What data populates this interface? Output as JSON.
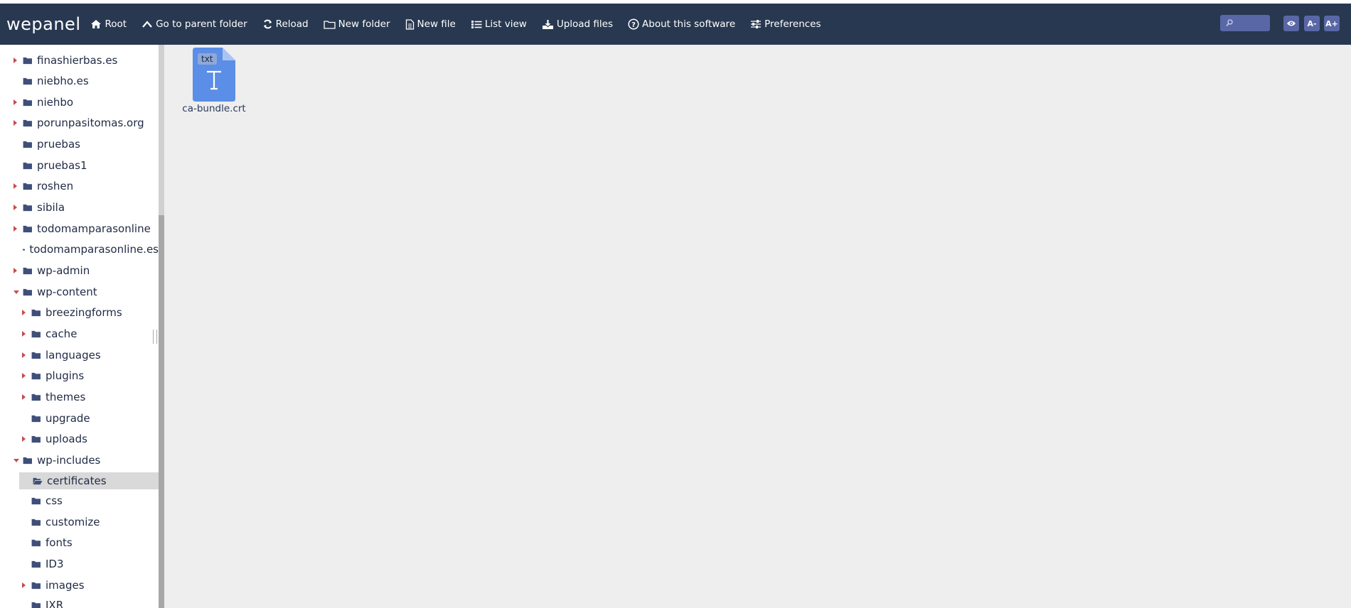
{
  "app": {
    "logo": "wepanel"
  },
  "toolbar": {
    "root": "Root",
    "parent": "Go to parent folder",
    "reload": "Reload",
    "new_folder": "New folder",
    "new_file": "New file",
    "list_view": "List view",
    "upload": "Upload files",
    "about": "About this software",
    "preferences": "Preferences"
  },
  "search": {
    "placeholder": ""
  },
  "buttons": {
    "font_decrease": "A-",
    "font_increase": "A+"
  },
  "tree": {
    "items": [
      {
        "label": "finashierbas.es"
      },
      {
        "label": "niebho.es"
      },
      {
        "label": "niehbo"
      },
      {
        "label": "porunpasitomas.org"
      },
      {
        "label": "pruebas"
      },
      {
        "label": "pruebas1"
      },
      {
        "label": "roshen"
      },
      {
        "label": "sibila"
      },
      {
        "label": "todomamparasonline"
      },
      {
        "label": "todomamparasonline.es"
      },
      {
        "label": "wp-admin"
      },
      {
        "label": "wp-content"
      },
      {
        "label": "breezingforms"
      },
      {
        "label": "cache"
      },
      {
        "label": "languages"
      },
      {
        "label": "plugins"
      },
      {
        "label": "themes"
      },
      {
        "label": "upgrade"
      },
      {
        "label": "uploads"
      },
      {
        "label": "wp-includes"
      },
      {
        "label": "certificates"
      },
      {
        "label": "css"
      },
      {
        "label": "customize"
      },
      {
        "label": "fonts"
      },
      {
        "label": "ID3"
      },
      {
        "label": "images"
      },
      {
        "label": "IXR"
      }
    ]
  },
  "files": [
    {
      "name": "ca-bundle.crt",
      "badge": "txt"
    }
  ],
  "colors": {
    "navbar": "#283850",
    "accent": "#5a67a6",
    "folder": "#3f4f7a",
    "arrow": "#c94b4b",
    "file": "#5b8ee6"
  }
}
